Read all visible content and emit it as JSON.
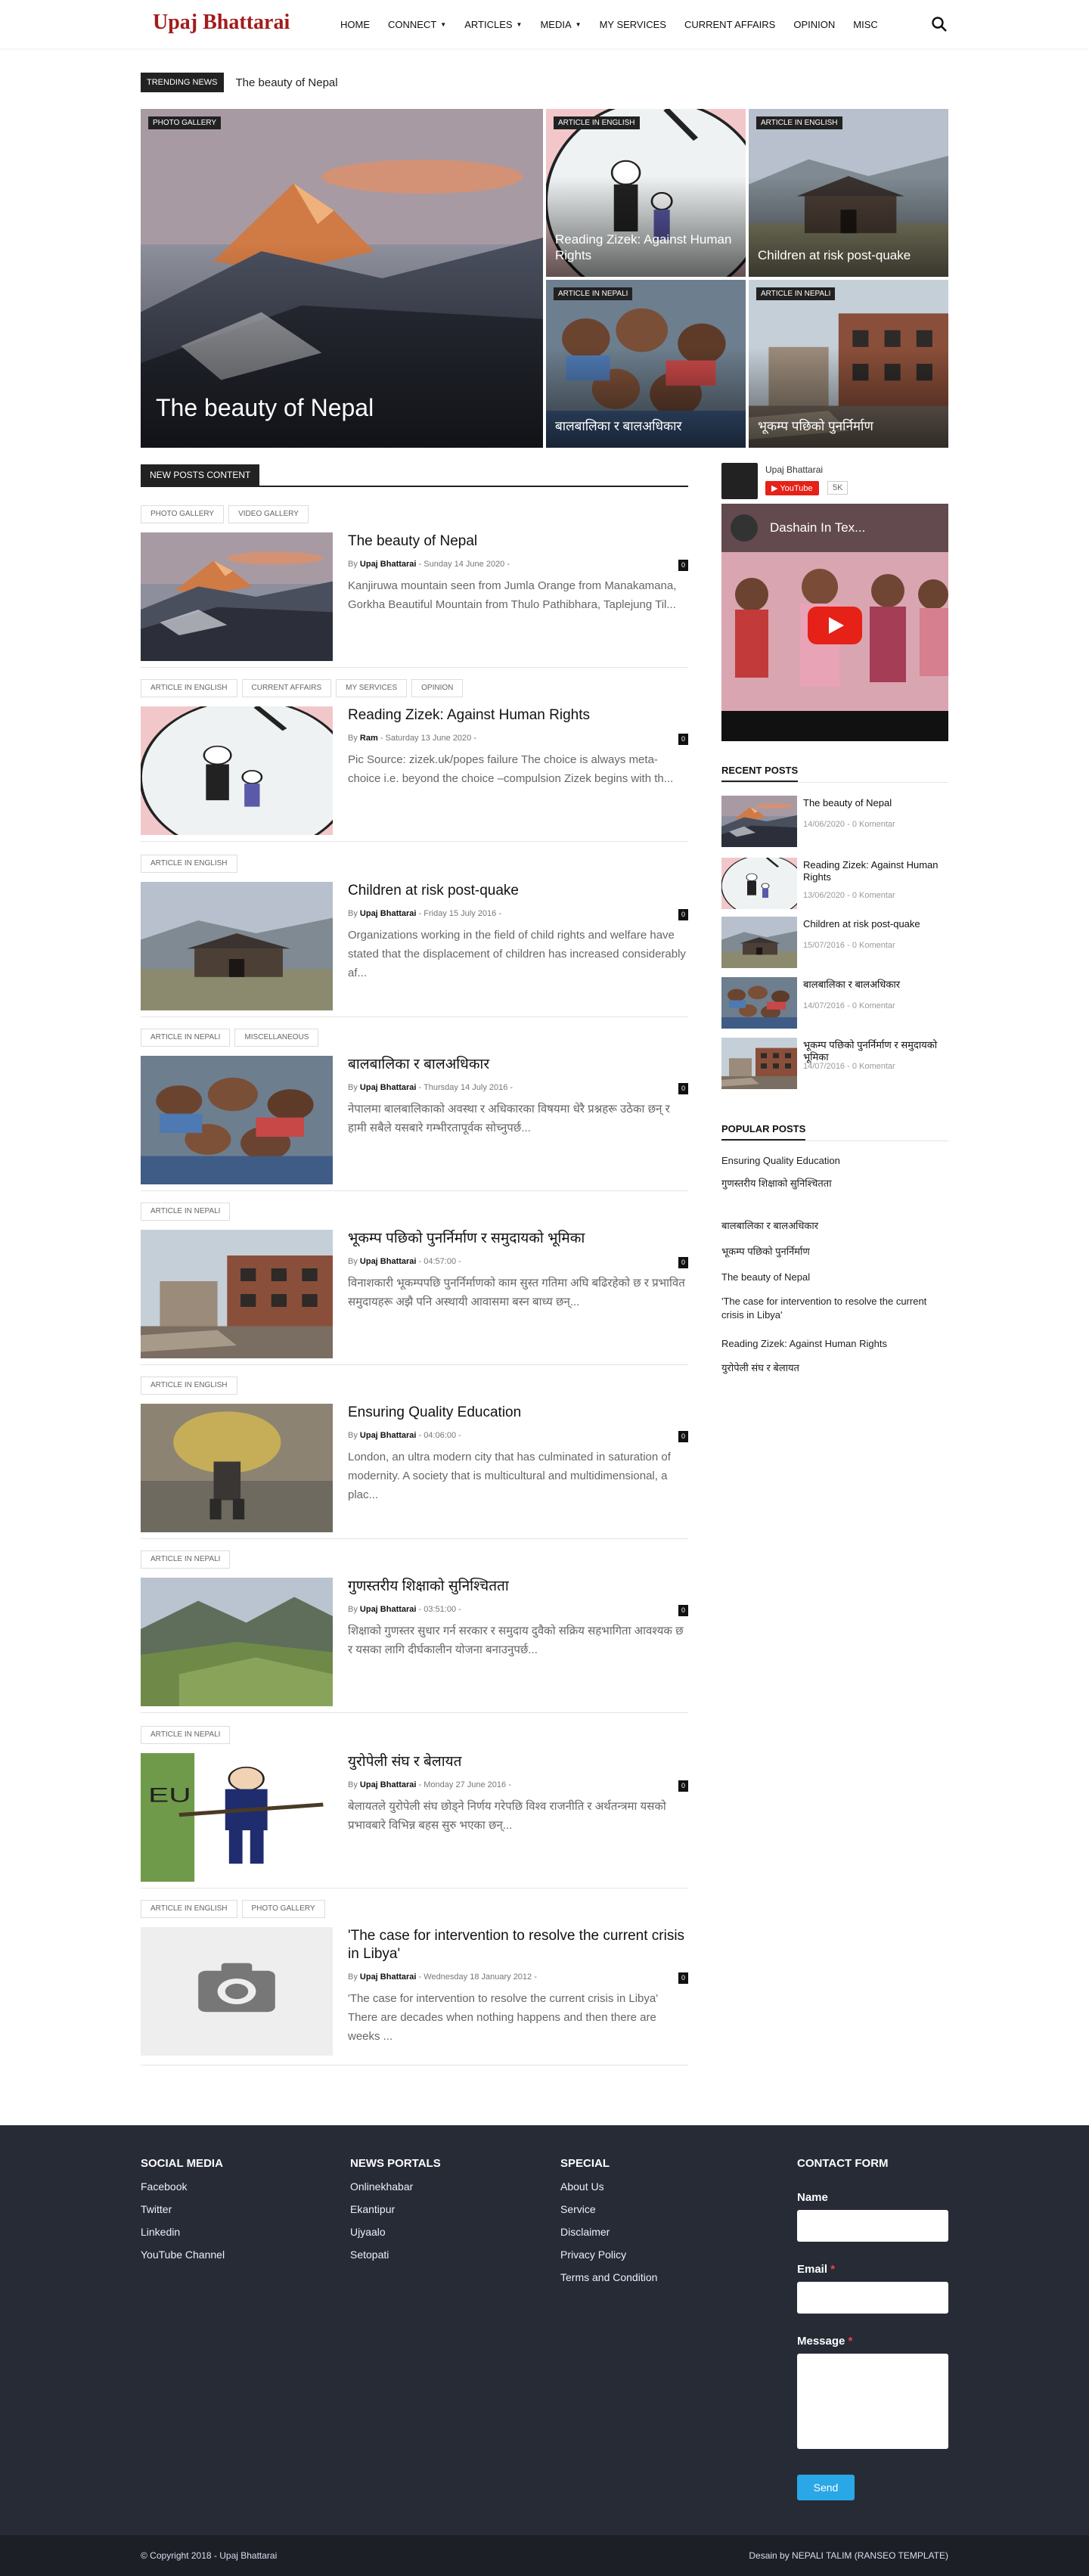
{
  "site": {
    "title": "Upaj Bhattarai"
  },
  "nav": [
    {
      "label": "HOME",
      "dropdown": false
    },
    {
      "label": "CONNECT",
      "dropdown": true
    },
    {
      "label": "ARTICLES",
      "dropdown": true
    },
    {
      "label": "MEDIA",
      "dropdown": true
    },
    {
      "label": "MY SERVICES",
      "dropdown": false
    },
    {
      "label": "CURRENT AFFAIRS",
      "dropdown": false
    },
    {
      "label": "OPINION",
      "dropdown": false
    },
    {
      "label": "MISC",
      "dropdown": false
    }
  ],
  "trending": {
    "label": "TRENDING NEWS",
    "text": "The beauty of Nepal"
  },
  "hero": [
    {
      "category": "PHOTO GALLERY",
      "title": "The beauty of Nepal",
      "image": "mountain"
    },
    {
      "category": "ARTICLE IN ENGLISH",
      "title": "Reading Zizek: Against Human Rights",
      "image": "cartoon"
    },
    {
      "category": "ARTICLE IN ENGLISH",
      "title": "Children at risk post-quake",
      "image": "house"
    },
    {
      "category": "ARTICLE IN NEPALI",
      "title": "बालबालिका र बालअधिकार",
      "image": "children"
    },
    {
      "category": "ARTICLE IN NEPALI",
      "title": "भूकम्प पछिको पुनर्निर्माण",
      "image": "street"
    }
  ],
  "section_title": "NEW POSTS CONTENT",
  "posts": [
    {
      "tags": [
        "PHOTO GALLERY",
        "VIDEO GALLERY"
      ],
      "title": "The beauty of Nepal",
      "author": "Upaj Bhattarai",
      "date": "Sunday 14 June 2020",
      "comments": "0",
      "excerpt": "Kanjiruwa mountain seen from Jumla  Orange from Manakamana, Gorkha Beautiful Mountain from Thulo Pathibhara, Taplejung  Til...",
      "image": "mountain"
    },
    {
      "tags": [
        "ARTICLE IN ENGLISH",
        "CURRENT AFFAIRS",
        "MY SERVICES",
        "OPINION"
      ],
      "title": "Reading Zizek: Against Human Rights",
      "author": "Ram",
      "date": "Saturday 13 June 2020",
      "comments": "0",
      "excerpt": "Pic Source: zizek.uk/popes failure The choice is always meta-choice i.e. beyond the choice –compulsion Zizek begins with th...",
      "image": "cartoon"
    },
    {
      "tags": [
        "ARTICLE IN ENGLISH"
      ],
      "title": "Children at risk post-quake",
      "author": "Upaj Bhattarai",
      "date": "Friday 15 July 2016",
      "comments": "0",
      "excerpt": "Organizations working in the field of child rights and welfare have stated that the displacement of children has increased considerably af...",
      "image": "house"
    },
    {
      "tags": [
        "ARTICLE IN NEPALI",
        "MISCELLANEOUS"
      ],
      "title": "बालबालिका र बालअधिकार",
      "author": "Upaj Bhattarai",
      "date": "Thursday 14 July 2016",
      "comments": "0",
      "excerpt": "नेपालमा बालबालिकाको अवस्था र अधिकारका विषयमा धेरै प्रश्नहरू उठेका छन् र हामी सबैले यसबारे गम्भीरतापूर्वक सोच्नुपर्छ...",
      "image": "children"
    },
    {
      "tags": [
        "ARTICLE IN NEPALI"
      ],
      "title": "भूकम्प पछिको पुनर्निर्माण र समुदायको भूमिका",
      "author": "Upaj Bhattarai",
      "date": "04:57:00",
      "comments": "0",
      "excerpt": "विनाशकारी भूकम्पपछि पुनर्निर्माणको काम सुस्त गतिमा अघि बढिरहेको छ र प्रभावित समुदायहरू अझै पनि अस्थायी आवासमा बस्न बाध्य छन्...",
      "image": "street"
    },
    {
      "tags": [
        "ARTICLE IN ENGLISH"
      ],
      "title": "Ensuring Quality Education",
      "author": "Upaj Bhattarai",
      "date": "04:06:00",
      "comments": "0",
      "excerpt": "London, an ultra modern city that has culminated in saturation of modernity. A society that is multicultural and multidimensional, a plac...",
      "image": "porter"
    },
    {
      "tags": [
        "ARTICLE IN NEPALI"
      ],
      "title": "गुणस्तरीय शिक्षाको सुनिश्चितता",
      "author": "Upaj Bhattarai",
      "date": "03:51:00",
      "comments": "0",
      "excerpt": "शिक्षाको गुणस्तर सुधार गर्न सरकार र समुदाय दुवैको सक्रिय सहभागिता आवश्यक छ र यसका लागि दीर्घकालीन योजना बनाउनुपर्छ...",
      "image": "valley"
    },
    {
      "tags": [
        "ARTICLE IN NEPALI"
      ],
      "title": "युरोपेली संघ र बेलायत",
      "author": "Upaj Bhattarai",
      "date": "Monday 27 June 2016",
      "comments": "0",
      "excerpt": "बेलायतले युरोपेली संघ छोड्ने निर्णय गरेपछि विश्व राजनीति र अर्थतन्त्रमा यसको प्रभावबारे विभिन्न बहस सुरु भएका छन्...",
      "image": "brexit"
    },
    {
      "tags": [
        "ARTICLE IN ENGLISH",
        "PHOTO GALLERY"
      ],
      "title": "'The case for intervention to resolve the current crisis in Libya'",
      "author": "Upaj Bhattarai",
      "date": "Wednesday 18 January 2012",
      "comments": "0",
      "excerpt": "'The case for intervention to resolve the current crisis in Libya' There are decades when nothing happens and then there are weeks ...",
      "image": "placeholder"
    }
  ],
  "youtube": {
    "channel": "Upaj Bhattarai",
    "button": "YouTube",
    "count": "5K",
    "video_title": "Dashain In Tex..."
  },
  "recent_posts": {
    "title": "RECENT POSTS",
    "items": [
      {
        "title": "The beauty of Nepal",
        "date": "14/06/2020",
        "comments": "0 Komentar",
        "image": "mountain"
      },
      {
        "title": "Reading Zizek: Against Human Rights",
        "date": "13/06/2020",
        "comments": "0 Komentar",
        "image": "cartoon"
      },
      {
        "title": "Children at risk post-quake",
        "date": "15/07/2016",
        "comments": "0 Komentar",
        "image": "house"
      },
      {
        "title": "बालबालिका र बालअधिकार",
        "date": "14/07/2016",
        "comments": "0 Komentar",
        "image": "children"
      },
      {
        "title": "भूकम्प पछिको पुनर्निर्माण र समुदायको भूमिका",
        "date": "14/07/2016",
        "comments": "0 Komentar",
        "image": "street"
      }
    ]
  },
  "popular_posts": {
    "title": "POPULAR POSTS",
    "items": [
      "Ensuring Quality Education",
      "गुणस्तरीय शिक्षाको सुनिश्चितता",
      "बालबालिका र बालअधिकार",
      "भूकम्प पछिको पुनर्निर्माण",
      "The beauty of Nepal",
      "'The case for intervention to resolve the current crisis in Libya'",
      "Reading Zizek: Against Human Rights",
      "युरोपेली संघ र बेलायत"
    ]
  },
  "footer": {
    "social": {
      "title": "SOCIAL MEDIA",
      "links": [
        "Facebook",
        "Twitter",
        "Linkedin",
        "YouTube Channel"
      ]
    },
    "portals": {
      "title": "NEWS PORTALS",
      "links": [
        "Onlinekhabar",
        "Ekantipur",
        "Ujyaalo",
        "Setopati"
      ]
    },
    "special": {
      "title": "SPECIAL",
      "links": [
        "About Us",
        "Service",
        "Disclaimer",
        "Privacy Policy",
        "Terms and Condition"
      ]
    },
    "contact": {
      "title": "CONTACT FORM",
      "name_label": "Name",
      "email_label": "Email",
      "message_label": "Message",
      "send": "Send"
    },
    "copyright": "© Copyright 2018 - Upaj Bhattarai",
    "design": "Desain by NEPALI TALIM (RANSEO TEMPLATE)"
  },
  "colors": {
    "brand": "#a31c1c",
    "footer_bg": "#262b36",
    "send_button": "#2aa7e6",
    "youtube_red": "#e62117"
  }
}
